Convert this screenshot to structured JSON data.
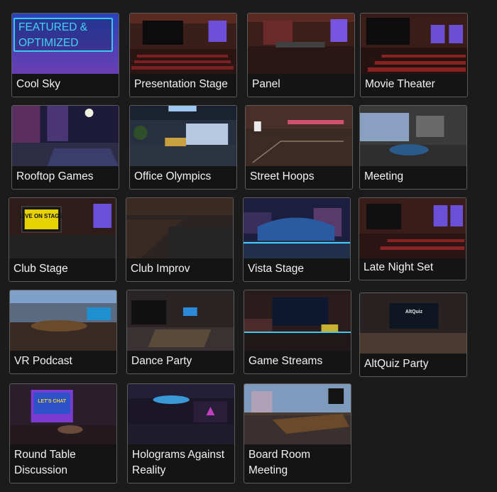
{
  "featured_badge": "FEATURED & OPTIMIZED",
  "environments": [
    {
      "label": "Cool Sky"
    },
    {
      "label": "Presentation Stage"
    },
    {
      "label": "Panel"
    },
    {
      "label": "Movie Theater"
    },
    {
      "label": "Rooftop Games"
    },
    {
      "label": "Office Olympics"
    },
    {
      "label": "Street Hoops"
    },
    {
      "label": "Meeting"
    },
    {
      "label": "Club Stage"
    },
    {
      "label": "Club Improv"
    },
    {
      "label": "Vista Stage"
    },
    {
      "label": "Late Night Set"
    },
    {
      "label": "VR Podcast"
    },
    {
      "label": "Dance Party"
    },
    {
      "label": "Game Streams"
    },
    {
      "label": "AltQuiz Party"
    },
    {
      "label": "Round Table Discussion"
    },
    {
      "label": "Holograms Against Reality"
    },
    {
      "label": "Board Room Meeting"
    }
  ],
  "stage_signs": {
    "club_stage": "LIVE ON STAGE",
    "round_table": "LET'S CHAT",
    "altquiz": "AltQuiz"
  },
  "colors": {
    "background": "#1b1b1b",
    "card_border": "#5c5c5c",
    "badge_cyan": "#45d2f0",
    "label_text": "#f2f2f2"
  }
}
